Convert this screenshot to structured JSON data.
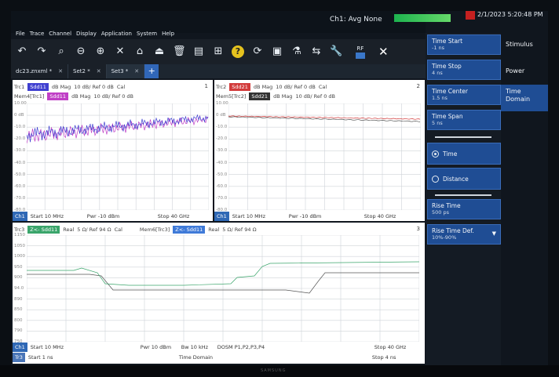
{
  "status": {
    "channel_avg": "Ch1: Avg None",
    "datetime": "2/1/2023 5:20:48 PM"
  },
  "menu": [
    "File",
    "Trace",
    "Channel",
    "Display",
    "Application",
    "System",
    "Help"
  ],
  "toolbar": {
    "icons": [
      "undo-icon",
      "redo-icon",
      "zoom-icon",
      "zoom-out-icon",
      "zoom-in-icon",
      "fit-icon",
      "trace-icon",
      "marker-icon",
      "delete-icon",
      "print-icon",
      "windows-icon",
      "help-icon",
      "refresh-icon",
      "display-icon",
      "cal-icon",
      "settings-icon",
      "wrench-icon"
    ],
    "rf_label": "RF"
  },
  "tabs": [
    {
      "label": "dc23.znxml *",
      "active": false
    },
    {
      "label": "Set2 *",
      "active": false
    },
    {
      "label": "Set3 *",
      "active": true
    }
  ],
  "windows": [
    {
      "number": "1",
      "traces": [
        {
          "name": "Trc1",
          "param": "Sdd11",
          "param_color": "#3f3fd0",
          "format": "dB Mag",
          "scale": "10 dB/ Ref 0 dB",
          "cal": "Cal"
        },
        {
          "name": "Mem4[Trc1]",
          "param": "Sdd11",
          "param_color": "#c03fc6",
          "format": "dB Mag",
          "scale": "10 dB/ Ref 0 dB",
          "cal": ""
        }
      ],
      "y_labels": [
        "10.00",
        "0 dB",
        "-10.0",
        "-20.0",
        "-30.0",
        "-40.0",
        "-50.0",
        "-60.0",
        "-70.0",
        "-80.0"
      ],
      "footer": {
        "ch": "Ch1",
        "start": "Start 10 MHz",
        "pwr": "Pwr -10 dBm",
        "stop": "Stop 40 GHz"
      }
    },
    {
      "number": "2",
      "traces": [
        {
          "name": "Trc2",
          "param": "Sdd21",
          "param_color": "#d23b3b",
          "format": "dB Mag",
          "scale": "10 dB/ Ref 0 dB",
          "cal": "Cal"
        },
        {
          "name": "Mem5[Trc2]",
          "param": "Sdd21",
          "param_color": "#333333",
          "format": "dB Mag",
          "scale": "10 dB/ Ref 0 dB",
          "cal": ""
        }
      ],
      "y_labels": [
        "10.00",
        "0 dB",
        "-10.0",
        "-20.0",
        "-30.0",
        "-40.0",
        "-50.0",
        "-60.0",
        "-70.0",
        "-80.0"
      ],
      "footer": {
        "ch": "Ch1",
        "start": "Start 10 MHz",
        "pwr": "Pwr -10 dBm",
        "stop": "Stop 40 GHz"
      }
    },
    {
      "number": "3",
      "traces": [
        {
          "name": "Trc3",
          "param": "Z<- Sdd11",
          "param_color": "#3aa56b",
          "format": "Real",
          "scale": "5 Ω/ Ref 94 Ω",
          "cal": "Cal"
        },
        {
          "name": "Mem6[Trc3]",
          "param": "Z<- Sdd11",
          "param_color": "#3f7ad8",
          "format": "Real",
          "scale": "5 Ω/ Ref 94 Ω",
          "cal": ""
        }
      ],
      "y_labels": [
        "1150",
        "1050",
        "1000",
        "950",
        "900",
        "94.0",
        "890",
        "850",
        "800",
        "790",
        "750"
      ],
      "footer1": {
        "ch": "Ch1",
        "start": "Start 10 MHz",
        "pwr": "Pwr 10 dBm",
        "bw": "Bw 10 kHz",
        "mode": "DOSM P1,P2,P3,P4",
        "stop": "Stop 40 GHz"
      },
      "footer2": {
        "ch": "Tr3",
        "start": "Start 1 ns",
        "mode": "Time Domain",
        "stop": "Stop 4 ns"
      }
    }
  ],
  "softkeys": {
    "time_start": {
      "label": "Time Start",
      "value": "-1 ns"
    },
    "time_stop": {
      "label": "Time Stop",
      "value": "4 ns"
    },
    "time_center": {
      "label": "Time Center",
      "value": "1.5 ns"
    },
    "time_span": {
      "label": "Time Span",
      "value": "5 ns"
    },
    "time_radio": {
      "label": "Time",
      "selected": true
    },
    "distance_radio": {
      "label": "Distance",
      "selected": false
    },
    "rise_time": {
      "label": "Rise Time",
      "value": "500 ps"
    },
    "rise_time_def": {
      "label": "Rise Time Def.",
      "value": "10%-90%"
    }
  },
  "menukeys": [
    "Stimulus",
    "Power",
    "Time Domain"
  ],
  "brand": "SAMSUNG"
}
